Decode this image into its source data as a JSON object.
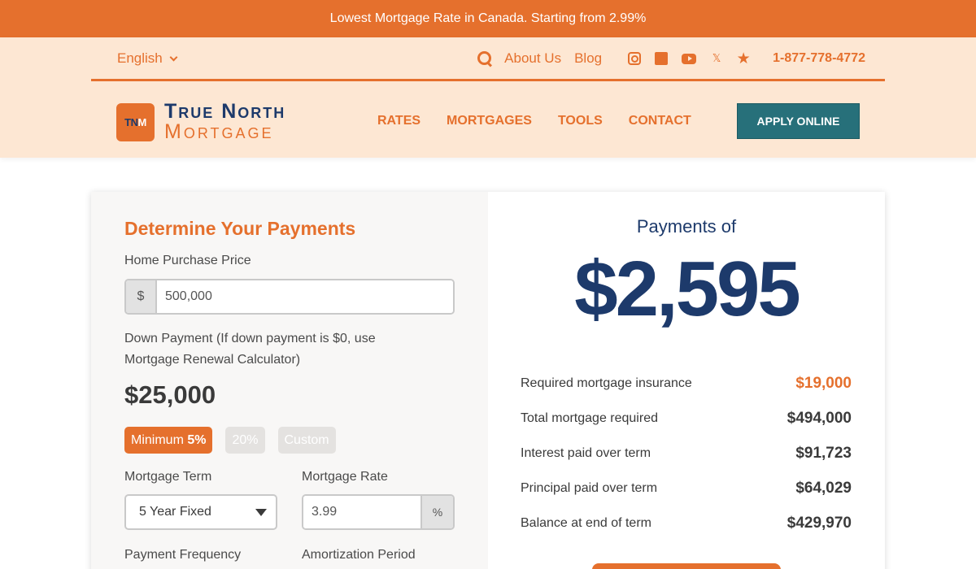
{
  "promo": {
    "text": "Lowest Mortgage Rate in Canada. Starting from 2.99%"
  },
  "utility": {
    "language": "English",
    "about": "About Us",
    "blog": "Blog",
    "social_icons": [
      "instagram-icon",
      "facebook-icon",
      "youtube-icon",
      "x-icon",
      "star-icon"
    ],
    "phone": "1-877-778-4772"
  },
  "logo": {
    "mark_left": "TN",
    "mark_right": "M",
    "line1": "True North",
    "line2": "Mortgage"
  },
  "nav": {
    "items": [
      "RATES",
      "MORTGAGES",
      "TOOLS",
      "CONTACT"
    ],
    "apply": "APPLY ONLINE"
  },
  "calculator": {
    "title": "Determine Your Payments",
    "price_label": "Home Purchase Price",
    "price_prefix": "$",
    "price_value": "500,000",
    "down_label_1": "Down Payment (If down payment is $0, use",
    "down_label_2": "Mortgage Renewal Calculator)",
    "down_amount": "$25,000",
    "pill_min_prefix": "Minimum ",
    "pill_min_value": "5%",
    "pill_20": "20%",
    "pill_custom": "Custom",
    "term_label": "Mortgage Term",
    "term_value": "5 Year Fixed",
    "rate_label": "Mortgage Rate",
    "rate_value": "3.99",
    "rate_suffix": "%",
    "frequency_label": "Payment Frequency",
    "amortization_label": "Amortization Period"
  },
  "results": {
    "label": "Payments of",
    "amount": "$2,595",
    "rows": [
      {
        "label": "Required mortgage insurance",
        "value": "$19,000"
      },
      {
        "label": "Total mortgage required",
        "value": "$494,000"
      },
      {
        "label": "Interest paid over term",
        "value": "$91,723"
      },
      {
        "label": "Principal paid over term",
        "value": "$64,029"
      },
      {
        "label": "Balance at end of term",
        "value": "$429,970"
      }
    ]
  },
  "colors": {
    "brand_orange": "#e5702d",
    "brand_navy": "#1d3a6b",
    "apply_teal": "#27707a",
    "header_bg": "#fde7d3"
  }
}
